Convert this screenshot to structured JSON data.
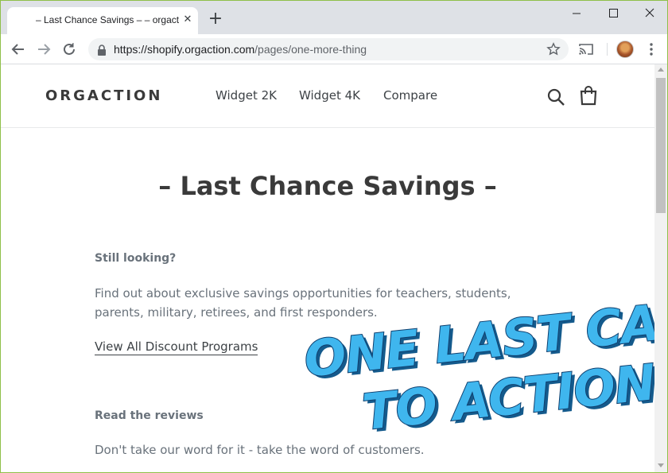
{
  "browser": {
    "tab_title": "– Last Chance Savings – – orgaction",
    "tab_close_glyph": "✕",
    "new_tab_glyph": "+",
    "url_host": "https://shopify.orgaction.com",
    "url_path": "/pages/one-more-thing"
  },
  "site": {
    "logo": "ORGACTION",
    "nav": [
      "Widget 2K",
      "Widget 4K",
      "Compare"
    ]
  },
  "page": {
    "title": "– Last Chance Savings –",
    "section1": {
      "heading": "Still looking?",
      "body": "Find out about exclusive savings opportunities for teachers, students, parents, military, retirees, and first responders.",
      "link": "View All Discount Programs"
    },
    "section2": {
      "heading": "Read the reviews",
      "body": "Don't take our word for it - take the word of customers."
    }
  },
  "overlay": {
    "line1": "ONE LAST CALL",
    "line2": "TO ACTION",
    "fill_color": "#3fb6ee",
    "outline_color": "#0f3f6e"
  },
  "colors": {
    "frame": "#8fc04a",
    "tabstrip": "#dee1e6",
    "heading_text": "#3a3a3a",
    "body_text": "#69727b"
  }
}
